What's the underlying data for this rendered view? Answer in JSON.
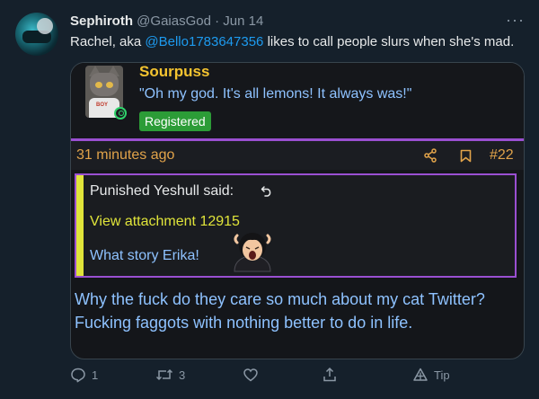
{
  "tweet": {
    "name": "Sephiroth",
    "handle": "@GaiasGod",
    "dot": "·",
    "date": "Jun 14",
    "more": "···",
    "text_before": "Rachel, aka ",
    "mention": "@Bello1783647356",
    "text_after": " likes to call people slurs when she's mad."
  },
  "forum_post": {
    "username": "Sourpuss",
    "user_quote": "\"Oh my god. It's all lemons! It always was!\"",
    "badge": "Registered",
    "avatar_shirt_text": "BOY",
    "timestamp": "31 minutes ago",
    "post_number": "#22",
    "quoted": {
      "author": "Punished Yeshull said:",
      "attachment": "View attachment 12915",
      "text": "What story Erika!"
    },
    "body": "Why the fuck do they care so much about my cat Twitter? Fucking faggots with nothing better to do in life."
  },
  "actions": {
    "reply_count": "1",
    "retweet_count": "3",
    "tip_label": "Tip"
  },
  "icons": [
    "share-icon",
    "bookmark-icon",
    "reply-arrow-icon",
    "comment-icon",
    "retweet-icon",
    "heart-icon",
    "share-tweet-icon",
    "tip-icon",
    "online-status-icon"
  ],
  "colors": {
    "background": "#15202b",
    "mention": "#1d9bf0",
    "forum_username": "#f4c430",
    "forum_quote": "#8ec2ff",
    "badge": "#2c9c37",
    "divider": "#9a4fd1",
    "timestamp": "#e1a34a",
    "attachment": "#e0e43a"
  }
}
